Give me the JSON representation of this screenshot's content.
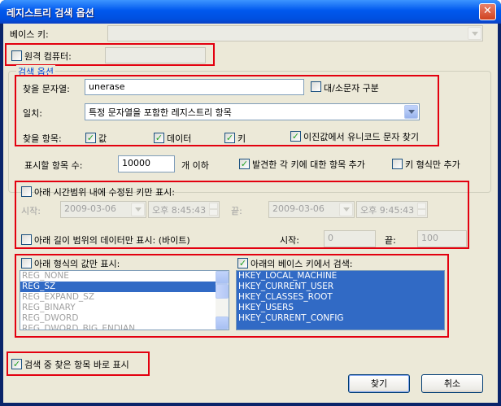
{
  "window": {
    "title": "레지스트리 검색 옵션",
    "close": "✕"
  },
  "base_key": {
    "label": "베이스 키:",
    "value": ""
  },
  "remote": {
    "label": "원격 컴퓨터:",
    "value": "",
    "checked": false
  },
  "search_group": {
    "title": "검색 옵션"
  },
  "find_string": {
    "label": "찾을 문자열:",
    "value": "unerase"
  },
  "case": {
    "label": "대/소문자 구분",
    "checked": false
  },
  "match": {
    "label": "일치:",
    "value": "특정 문자열을 포함한 레지스트리 항목"
  },
  "find_items": {
    "label": "찾을 항목:",
    "value_label": "값",
    "data_label": "데이터",
    "key_label": "키",
    "binary_label": "이진값에서 유니코드 문자 찾기",
    "check": "✓"
  },
  "display": {
    "label": "표시할 항목 수:",
    "value": "10000",
    "suffix": "개 이하",
    "add_key_label": "발견한 각 키에 대한 항목 추가",
    "key_only_label": "키 형식만 추가"
  },
  "time_range": {
    "label": "아래 시간범위 내에 수정된 키만 표시:",
    "start_label": "시작:",
    "start_date": "2009-03-06",
    "start_time": "오후  8:45:43",
    "end_label": "끝:",
    "end_date": "2009-03-06",
    "end_time": "오후  9:45:43"
  },
  "length_range": {
    "label": "아래 길이 범위의 데이터만 표시: (바이트)",
    "start_label": "시작:",
    "start_value": "0",
    "end_label": "끝:",
    "end_value": "100"
  },
  "types": {
    "label": "아래 형식의 값만 표시:",
    "items": [
      "REG_NONE",
      "REG_SZ",
      "REG_EXPAND_SZ",
      "REG_BINARY",
      "REG_DWORD",
      "REG_DWORD_BIG_ENDIAN"
    ]
  },
  "base_keys": {
    "label": "아래의 베이스 키에서 검색:",
    "items": [
      "HKEY_LOCAL_MACHINE",
      "HKEY_CURRENT_USER",
      "HKEY_CLASSES_ROOT",
      "HKEY_USERS",
      "HKEY_CURRENT_CONFIG"
    ]
  },
  "show_immediately": {
    "label": "검색 중 찾은 항목 바로 표시"
  },
  "buttons": {
    "find": "찾기",
    "cancel": "취소"
  }
}
